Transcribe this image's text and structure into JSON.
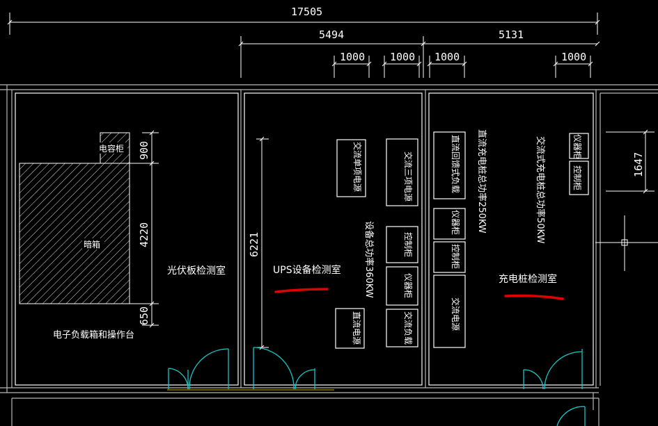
{
  "dimensions": {
    "total": "17505",
    "left_span": "5494",
    "right_span": "5131",
    "width_a": "1000",
    "width_b": "1000",
    "width_c": "1000",
    "width_d": "1000",
    "height_left": "4220",
    "top_small": "900",
    "bottom_small": "650",
    "ups_height": "6221",
    "right_room": "1647"
  },
  "rooms": {
    "pv_lab": "光伏板检测室",
    "ups_lab": "UPS设备检测室",
    "charger_lab": "充电桩检测室"
  },
  "equipment": {
    "capacitor_cabinet": "电容柜",
    "dark_box": "暗箱",
    "electronic_load": "电子负载箱和操作台",
    "ac_single_phase": "交流单项电源",
    "ac_three_phase": "交流三项电源",
    "control_cabinet_1": "控制柜",
    "instrument_cabinet_1": "仪器柜",
    "ac_load": "交流负载",
    "dc_power": "直流电源",
    "dc_feedback_load": "直流回馈式负载",
    "instrument_cabinet_2": "仪器柜",
    "control_cabinet_2": "控制柜",
    "ac_power": "交流电源",
    "instrument_cabinet_3": "仪器柜",
    "control_cabinet_3": "控制柜"
  },
  "notes": {
    "ups_total_power": "设备总功率360KW",
    "dc_charger_power": "直流充电桩总功率250KW",
    "ac_charger_power": "交流式充电桩总功率50KW"
  },
  "colors": {
    "background": "#000000",
    "lines": "#ffffff",
    "door": "#14c8c8",
    "highlight": "#e00000"
  }
}
